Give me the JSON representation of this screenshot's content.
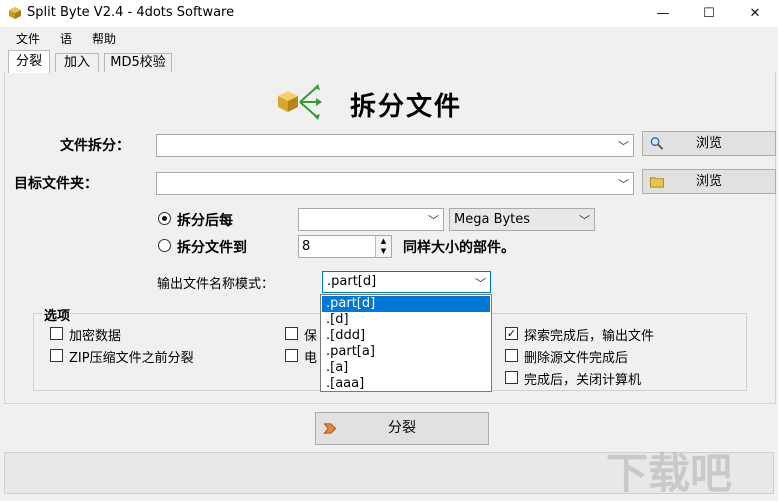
{
  "window": {
    "title": "Split Byte V2.4 - 4dots Software",
    "min": "—",
    "max": "☐",
    "close": "✕"
  },
  "menu": [
    "文件",
    "语",
    "帮助"
  ],
  "tabs": [
    "分裂",
    "加入",
    "MD5校验"
  ],
  "header": {
    "title": "拆分文件"
  },
  "form": {
    "split_file_label": "文件拆分：",
    "browse1": "浏览",
    "target_folder_label": "目标文件夹：",
    "browse2": "浏览",
    "radio_each": "拆分后每",
    "unit_value": "Mega Bytes",
    "radio_parts": "拆分文件到",
    "parts_count": "8",
    "parts_suffix": "同样大小的部件。",
    "pattern_label": "输出文件名称模式：",
    "pattern_value": ".part[d]"
  },
  "dropdown": [
    ".part[d]",
    ".[d]",
    ".[ddd]",
    ".part[a]",
    ".[a]",
    ".[aaa]"
  ],
  "options": {
    "title": "选项",
    "encrypt": "加密数据",
    "zip_before": "ZIP压缩文件之前分裂",
    "keep": "保",
    "email": "电",
    "explore_after": "探索完成后，输出文件",
    "delete_source": "删除源文件完成后",
    "shutdown": "完成后，关闭计算机"
  },
  "split_button": "分裂",
  "watermark": "下载吧",
  "colors": {
    "selection": "#0078d7",
    "window_bg": "#f0f0f0"
  }
}
